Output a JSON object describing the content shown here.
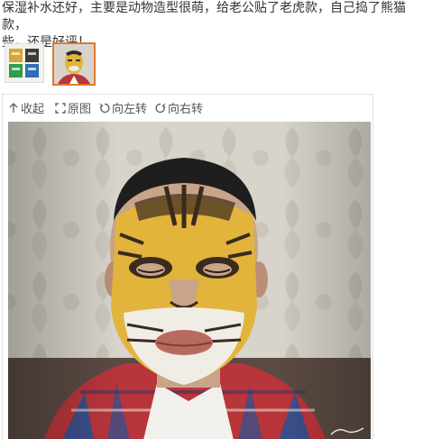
{
  "review": {
    "line1": "保湿补水还好，主要是动物造型很萌，给老公贴了老虎款，自己捣了熊猫款，",
    "line2": "些，还是好评！"
  },
  "thumbnails": [
    {
      "name": "mask-packs-thumbnail",
      "colors": [
        "#d9a632",
        "#2e9e4a",
        "#2f6fb5",
        "#3a3a3a"
      ]
    },
    {
      "name": "tiger-mask-photo-thumbnail",
      "selected": true,
      "accent": "#e07a2e"
    }
  ],
  "toolbar": {
    "collapse_label": "收起",
    "original_label": "原图",
    "rotate_left_label": "向左转",
    "rotate_right_label": "向右转"
  },
  "photo": {
    "subject": "man-wearing-tiger-face-mask",
    "colors": {
      "wallpaper": "#d8d4cc",
      "skin": "#c9a48a",
      "tiger_yellow": "#e2b43c",
      "tiger_stripe": "#3b2a1e",
      "shirt_red": "#b8353a",
      "shirt_blue": "#3b4f8a"
    }
  }
}
